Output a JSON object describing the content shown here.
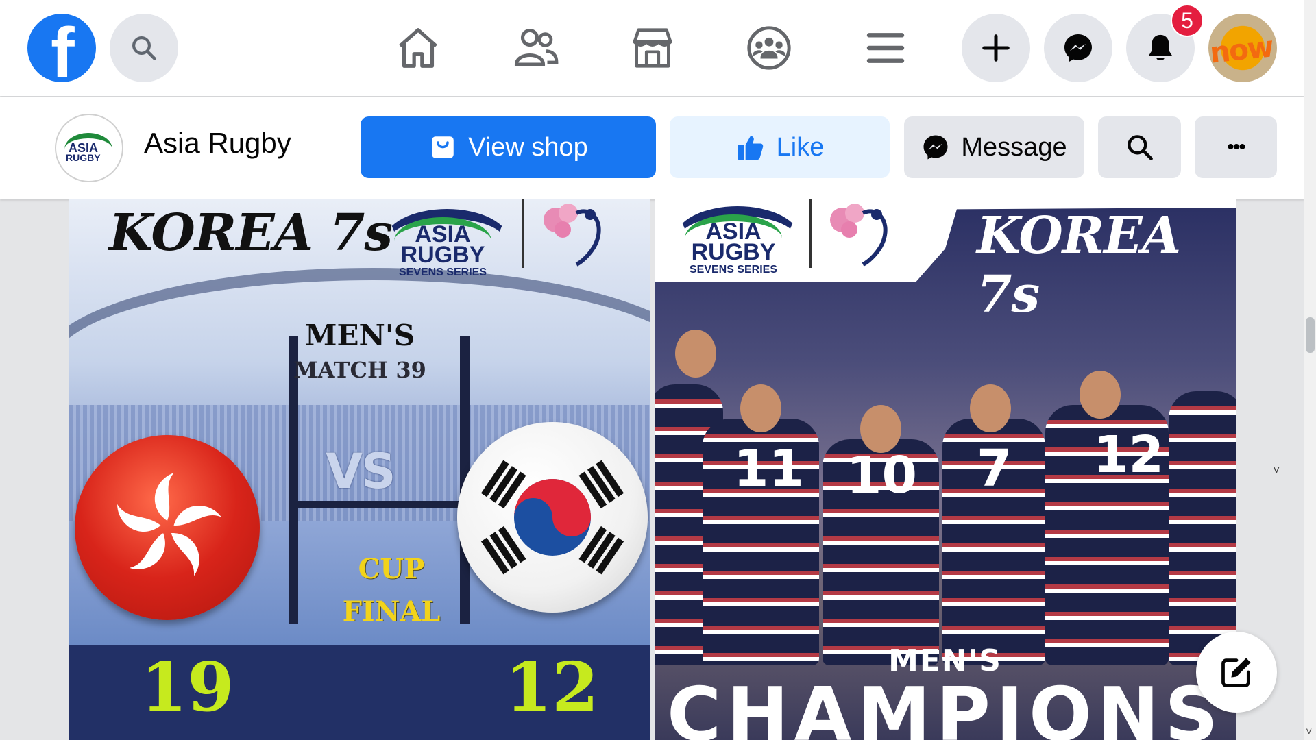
{
  "colors": {
    "brand": "#1877f2",
    "notification": "#e41e3f",
    "score": "#c6ea1e",
    "score_band": "#223066"
  },
  "topnav": {
    "logo_letter": "f",
    "icons": [
      "search-icon",
      "home-icon",
      "friends-icon",
      "marketplace-icon",
      "groups-icon",
      "menu-icon",
      "create-icon",
      "messenger-icon",
      "notifications-icon"
    ],
    "notification_count": "5",
    "avatar_text": "now"
  },
  "page": {
    "name": "Asia Rugby",
    "avatar_text_1": "ASIA",
    "avatar_text_2": "RUGBY",
    "buttons": {
      "view_shop": "View shop",
      "like": "Like",
      "message": "Message",
      "more": "•••"
    }
  },
  "post_left": {
    "event": "KOREA 7s",
    "logo_line1": "ASIA",
    "logo_line2": "RUGBY",
    "logo_line3": "SEVENS SERIES",
    "category": "MEN'S",
    "match": "MATCH 39",
    "vs": "VS",
    "stage_line1": "CUP",
    "stage_line2": "FINAL",
    "score_left": "19",
    "score_right": "12"
  },
  "post_right": {
    "event": "KOREA 7s",
    "logo_line1": "ASIA",
    "logo_line2": "RUGBY",
    "logo_line3": "SEVENS SERIES",
    "jersey_numbers": [
      "11",
      "10",
      "7",
      "12"
    ],
    "headline_1": "MEN'S",
    "headline_2": "CHAMPIONS"
  },
  "scroll_arrow": "˅"
}
